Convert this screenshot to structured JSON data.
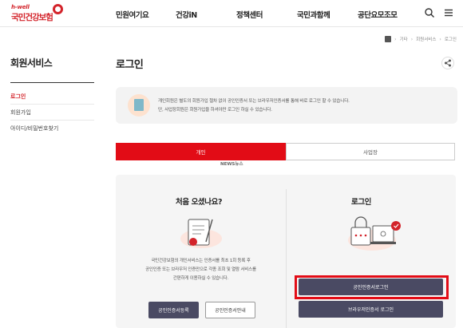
{
  "logo": {
    "sub": "h-well",
    "name": "국민건강보험"
  },
  "nav": [
    "민원여기요",
    "건강iN",
    "정책센터",
    "국민과함께",
    "공단요모조모"
  ],
  "header_icons": [
    "search-icon",
    "menu-icon"
  ],
  "breadcrumb": [
    "기타",
    "회원서비스",
    "로그인"
  ],
  "sidebar": {
    "title": "회원서비스",
    "items": [
      "로그인",
      "회원가입",
      "아이디/비밀번호찾기"
    ]
  },
  "page": {
    "title": "로그인"
  },
  "notice": {
    "line1": "개인회원은 별도의 회원가입 절차 없이 공인인증서 또는 브라우저인증서를 통해 바로 로그인 할 수 있습니다.",
    "line2": "단, 사업장회원은 회원가입을 하셔야만 로그인 하실 수 있습니다."
  },
  "tabs": [
    "개인",
    "사업장"
  ],
  "watermark": "NEWS뉴스",
  "first_visit": {
    "heading": "처음 오셨나요?",
    "desc": [
      "국민건강보험의 개인서비스는 인증서를 최초 1회 등록 후",
      "공인인증 또는 브라우저 인증만으로 각종 조회 및 열람 서비스를",
      "간편하게 이용하실 수 있습니다."
    ],
    "register_label": "공인인증서등록",
    "guide_label": "공인인증서안내"
  },
  "login": {
    "heading": "로그인",
    "cert_login_label": "공인인증서로그인",
    "browser_login_label": "브라우저인증서 로그인"
  },
  "colors": {
    "brand_red": "#d3232a",
    "tab_red": "#e20c16",
    "button_navy": "#4a4a63"
  }
}
